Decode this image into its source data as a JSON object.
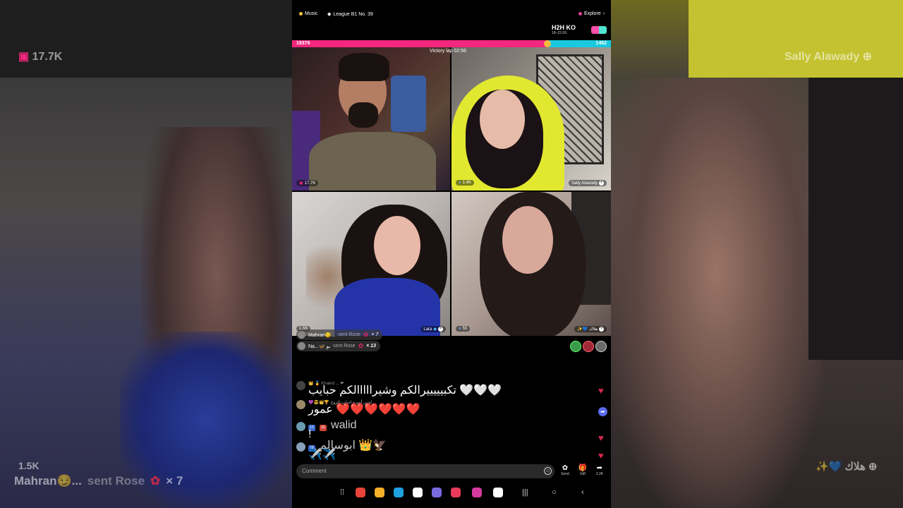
{
  "topbar": {
    "music_label": "Music",
    "league_label": "League B1 No. 39",
    "explore_label": "Explore"
  },
  "battle": {
    "mode": "H2H KO",
    "dates": "18–22.09.",
    "left_score": "19376",
    "right_score": "1462",
    "left_fraction": 0.8,
    "timer_label": "Victory lap",
    "timer_value": "02:56",
    "colors": {
      "left": "#f4277e",
      "right": "#19c9dd"
    }
  },
  "tiles": [
    {
      "name": "",
      "count": "17.7K"
    },
    {
      "name": "Sally Alawady",
      "count": "1.4K"
    },
    {
      "name": "Lara",
      "count": "1.5K"
    },
    {
      "name": "هلاك",
      "count": "55"
    }
  ],
  "gifts": [
    {
      "user": "Mahran😏...",
      "action": "sent Rose",
      "mult": "× 7"
    },
    {
      "user": "Na...🦋 بو",
      "action": "sent Rose",
      "mult": "× 13"
    }
  ],
  "comments": [
    {
      "line1": "👑 🏅 Khaled ...  ❤",
      "line2": "تكبيييييرالكم وشيرااااالكم حبايب 🤍🤍🤍"
    },
    {
      "line1": "💜😎👑🏆 لجين أميرة احباب الزوج",
      "line2": "عمور ❤️❤️❤️❤️❤️❤️"
    },
    {
      "badge1": "13",
      "badge2": "16",
      "user": "walid",
      "text": "!"
    },
    {
      "badge1": "19",
      "user": "ابوسالم 👑🦅",
      "text": "✈️✈️"
    }
  ],
  "bottom": {
    "comment_placeholder": "Comment",
    "send_label": "Send",
    "gift_label": "Gift",
    "share_count": "2.2K"
  },
  "background": {
    "left_count": "17.7K",
    "left_badge": "1.5K",
    "left_user": "Mahran😏...",
    "left_action": "sent Rose",
    "left_mult": "× 7",
    "right_name": "Sally Alawady",
    "right_tag": "هلاك"
  },
  "icons": {
    "music": "music-dot-icon",
    "explore": "explore-dot-icon",
    "rose": "rose-icon",
    "send": "send-rose-icon",
    "gift": "gift-icon",
    "share": "share-icon"
  }
}
